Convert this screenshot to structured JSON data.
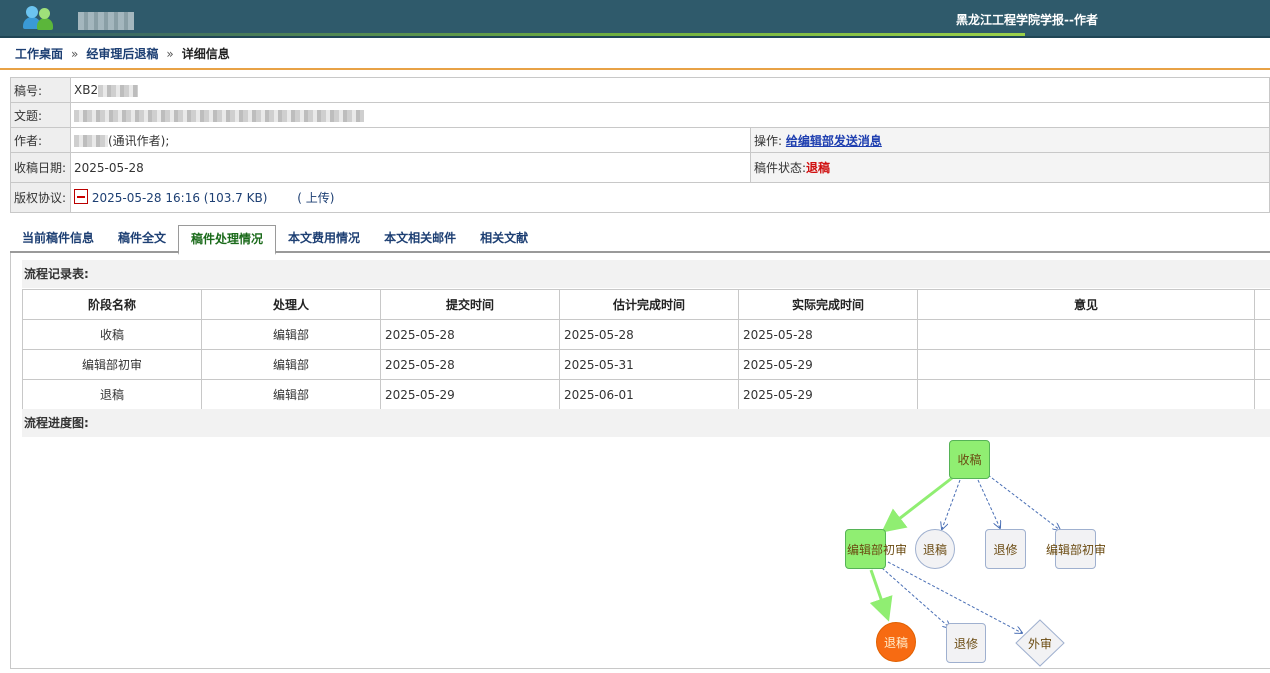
{
  "header": {
    "journal_title": "黑龙江工程学院学报--作者"
  },
  "breadcrumb": {
    "home": "工作桌面",
    "list": "经审理后退稿",
    "current": "详细信息",
    "separator": "»"
  },
  "info": {
    "manuscript_id_label": "稿号:",
    "manuscript_id_prefix": "XB2",
    "title_label": "文题:",
    "author_label": "作者:",
    "author_suffix": "(通讯作者);",
    "action_label": "操作:",
    "action_link": "给编辑部发送消息",
    "received_label": "收稿日期:",
    "received_date": "2025-05-28",
    "status_label": "稿件状态:",
    "status_value": "退稿",
    "copyright_label": "版权协议:",
    "copyright_file": "2025-05-28 16:16 (103.7 KB)",
    "upload_label": "( 上传)"
  },
  "tabs": [
    {
      "label": "当前稿件信息",
      "active": false
    },
    {
      "label": "稿件全文",
      "active": false
    },
    {
      "label": "稿件处理情况",
      "active": true
    },
    {
      "label": "本文费用情况",
      "active": false
    },
    {
      "label": "本文相关邮件",
      "active": false
    },
    {
      "label": "相关文献",
      "active": false
    }
  ],
  "flow_record": {
    "title": "流程记录表:",
    "headers": [
      "阶段名称",
      "处理人",
      "提交时间",
      "估计完成时间",
      "实际完成时间",
      "意见"
    ],
    "rows": [
      [
        "收稿",
        "编辑部",
        "2025-05-28",
        "2025-05-28",
        "2025-05-28",
        ""
      ],
      [
        "编辑部初审",
        "编辑部",
        "2025-05-28",
        "2025-05-31",
        "2025-05-29",
        ""
      ],
      [
        "退稿",
        "编辑部",
        "2025-05-29",
        "2025-06-01",
        "2025-05-29",
        ""
      ]
    ]
  },
  "flow_chart": {
    "title": "流程进度图:",
    "nodes": {
      "received": "收稿",
      "first_review": "编辑部初审",
      "reject_a": "退稿",
      "revise_a": "退修",
      "review_b": "编辑部初审",
      "reject_current": "退稿",
      "revise_b": "退修",
      "external": "外审"
    },
    "colors": {
      "done": "#90ee72",
      "current": "#f76b12",
      "pending": "#f2f2f4",
      "active_edge": "#90ee72",
      "pending_edge": "#4a6fb5"
    }
  }
}
